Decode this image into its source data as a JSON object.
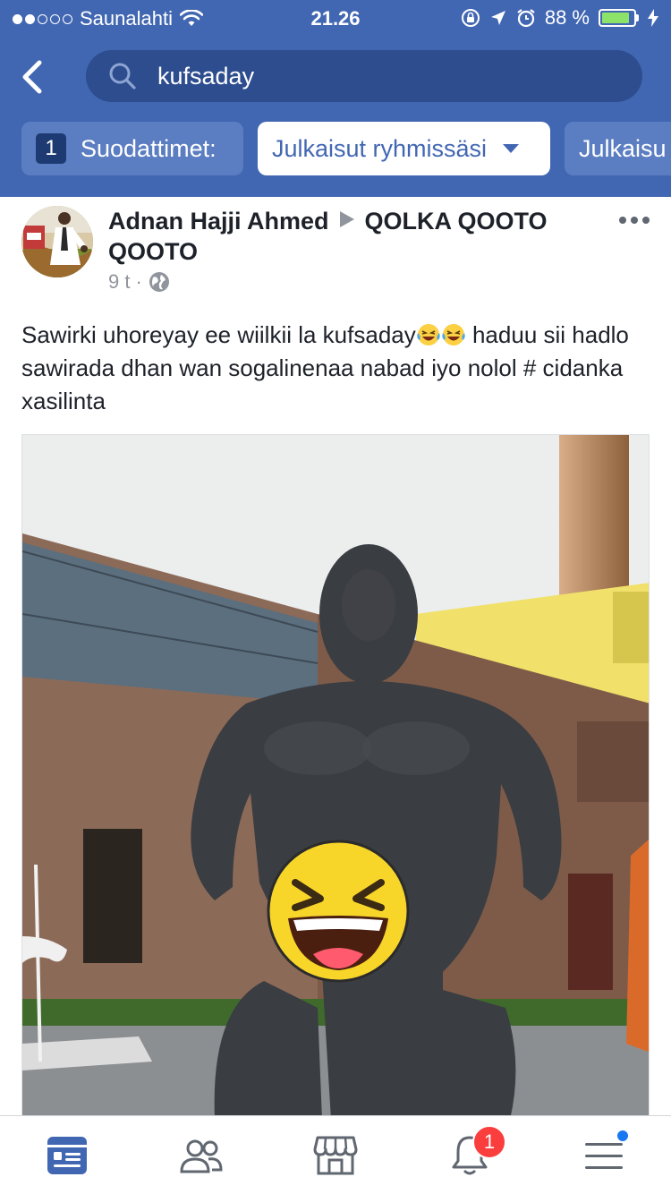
{
  "status_bar": {
    "carrier": "Saunalahti",
    "time": "21.26",
    "battery_percent": "88 %",
    "battery_level": 0.88,
    "signal_bars_filled": 2,
    "signal_bars_total": 5
  },
  "search": {
    "query": "kufsaday"
  },
  "filters": {
    "count": "1",
    "label": "Suodattimet:",
    "selected": "Julkaisut ryhmissäsi",
    "next_chip": "Julkaisu"
  },
  "post": {
    "author": "Adnan Hajji Ahmed",
    "group": "QOLKA QOOTO QOOTO",
    "time": "9 t",
    "separator": "·",
    "text_part1": "Sawirki uhoreyay ee wiilkii la kufsaday",
    "text_part2": " haduu sii hadlo sawirada dhan wan sogalinenaa nabad iyo nolol # cidanka xasilinta",
    "emojis": [
      "laughing-tears-emoji",
      "laughing-tears-emoji"
    ]
  },
  "tabbar": {
    "items": [
      "news-feed",
      "friends",
      "marketplace",
      "notifications",
      "menu"
    ],
    "notifications_badge": "1"
  },
  "colors": {
    "brand_blue": "#4267b2",
    "search_bg": "#2d4d8f",
    "chip_bg": "#5b7dc1",
    "badge_red": "#fa3e3e"
  }
}
